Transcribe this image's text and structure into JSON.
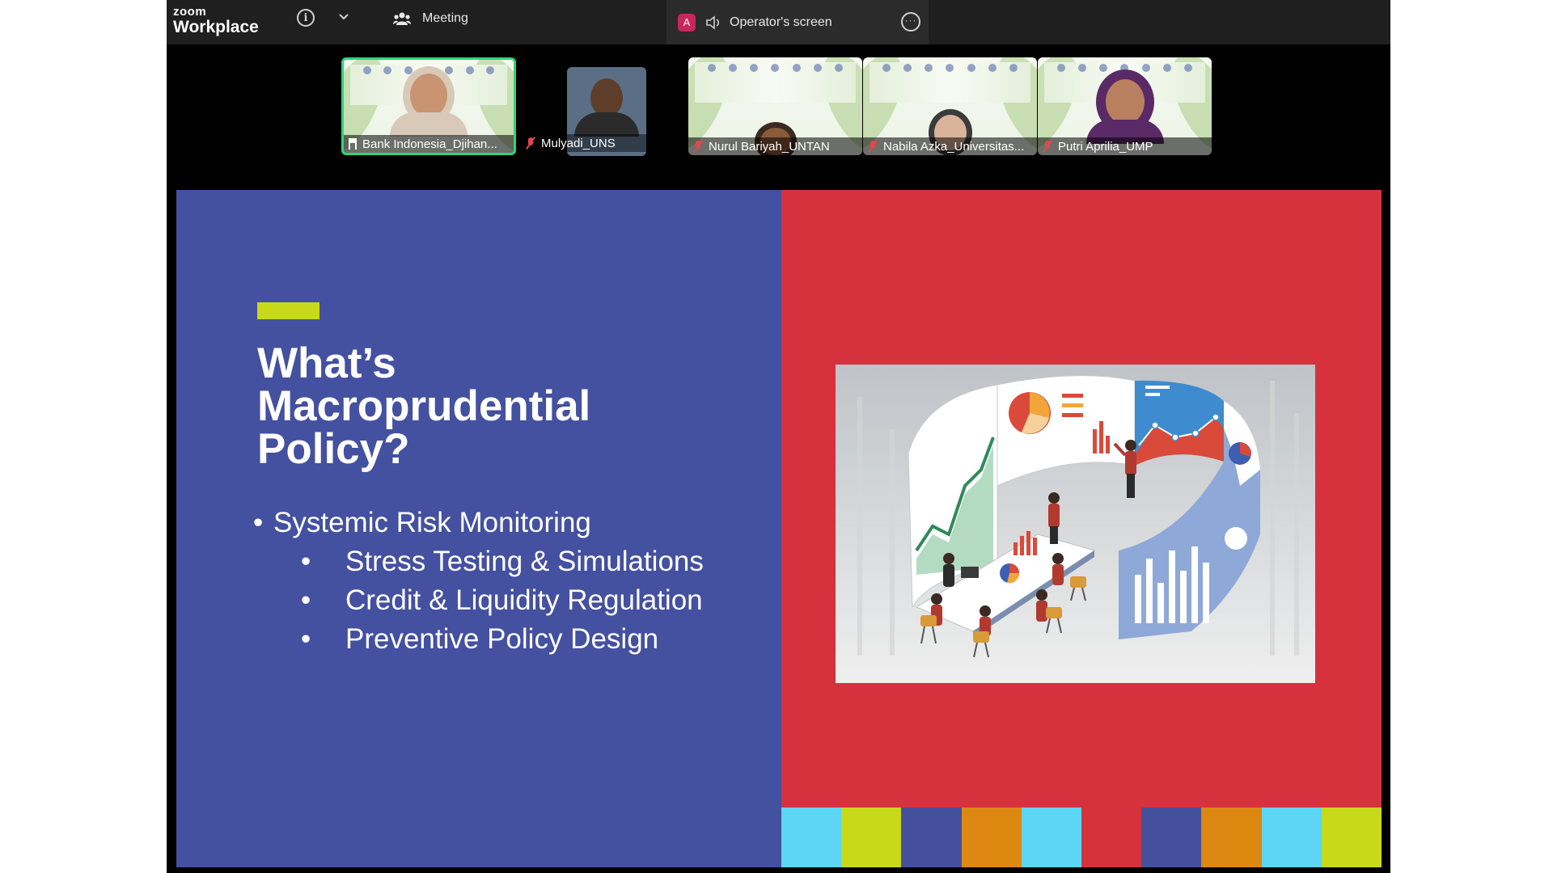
{
  "app": {
    "brand_top": "zoom",
    "brand_bottom": "Workplace",
    "meeting_label": "Meeting",
    "operator_avatar": "A",
    "operator_label": "Operator's screen",
    "icons": [
      "info-icon",
      "chevron-down-icon",
      "participants-icon",
      "speaker-icon",
      "more-icon"
    ]
  },
  "participants": [
    {
      "name": "Bank Indonesia_Djihan...",
      "mic": "pin",
      "active": true
    },
    {
      "name": "Mulyadi_UNS",
      "mic": "muted",
      "active": false
    },
    {
      "name": "Nurul Bariyah_UNTAN",
      "mic": "muted",
      "active": false
    },
    {
      "name": "Nabila Azka_Universitas...",
      "mic": "muted",
      "active": false
    },
    {
      "name": "Putri Aprilia_UMP",
      "mic": "muted",
      "active": false
    }
  ],
  "slide": {
    "title_line1": "What’s",
    "title_line2": "Macroprudential",
    "title_line3": "Policy?",
    "bullet_main": "Systemic Risk Monitoring",
    "bullet_glyph": "•",
    "sub_bullets": [
      "Stress Testing & Simulations",
      "Credit & Liquidity Regulation",
      "Preventive Policy Design"
    ],
    "colors": {
      "left_panel": "#4450a0",
      "right_panel": "#d5323e",
      "accent": "#c8d91a",
      "active_speaker_border": "#2fd47a"
    },
    "color_blocks": [
      "#5dd5f5",
      "#c8d91a",
      "#44509c",
      "#dd8810",
      "#5dd5f5",
      "#d5323e",
      "#44509c",
      "#dd8810",
      "#5dd5f5",
      "#c8d91a"
    ]
  }
}
